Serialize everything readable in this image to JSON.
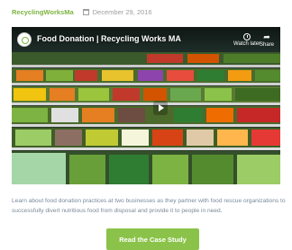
{
  "post": {
    "author": "RecyclingWorksMa",
    "date": "December 29, 2016"
  },
  "video": {
    "title": "Food Donation | Recycling Works MA",
    "watch_later_label": "Watch later",
    "share_label": "Share",
    "watch_later_icon": "clock-icon",
    "share_icon": "share-arrow-icon",
    "play_icon": "play-icon"
  },
  "description": "Learn about food donation practices at two businesses as they partner with food rescue organizations to successfully divert nutritious food from disposal and provide it to people in need.",
  "cta": {
    "label": "Read the Case Study",
    "color": "#8bc34a"
  },
  "colors": {
    "author": "#7cb342",
    "meta": "#9e9e9e",
    "body_text": "#7a8a99"
  }
}
